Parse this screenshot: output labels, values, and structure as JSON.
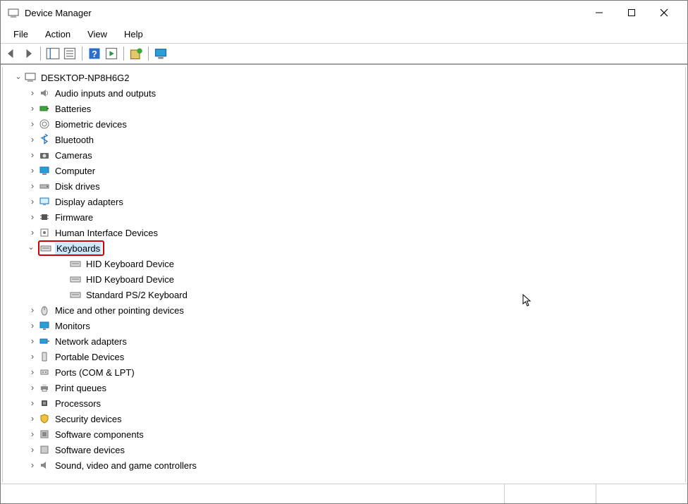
{
  "window": {
    "title": "Device Manager"
  },
  "menubar": {
    "items": [
      "File",
      "Action",
      "View",
      "Help"
    ]
  },
  "toolbar": {
    "buttons": [
      "back",
      "forward",
      "sep",
      "show-hide",
      "properties",
      "sep",
      "help",
      "action-center",
      "sep",
      "update-driver",
      "sep",
      "scan-hardware"
    ]
  },
  "tree": {
    "root": "DESKTOP-NP8H6G2",
    "selected": "Keyboards",
    "nodes": [
      {
        "label": "Audio inputs and outputs",
        "icon": "speaker"
      },
      {
        "label": "Batteries",
        "icon": "battery"
      },
      {
        "label": "Biometric devices",
        "icon": "fingerprint"
      },
      {
        "label": "Bluetooth",
        "icon": "bluetooth"
      },
      {
        "label": "Cameras",
        "icon": "camera"
      },
      {
        "label": "Computer",
        "icon": "computer"
      },
      {
        "label": "Disk drives",
        "icon": "disk"
      },
      {
        "label": "Display adapters",
        "icon": "display"
      },
      {
        "label": "Firmware",
        "icon": "chip"
      },
      {
        "label": "Human Interface Devices",
        "icon": "hid"
      },
      {
        "label": "Keyboards",
        "icon": "keyboard",
        "expanded": true,
        "highlighted": true,
        "selected": true,
        "children": [
          {
            "label": "HID Keyboard Device",
            "icon": "keyboard"
          },
          {
            "label": "HID Keyboard Device",
            "icon": "keyboard"
          },
          {
            "label": "Standard PS/2 Keyboard",
            "icon": "keyboard"
          }
        ]
      },
      {
        "label": "Mice and other pointing devices",
        "icon": "mouse"
      },
      {
        "label": "Monitors",
        "icon": "monitor"
      },
      {
        "label": "Network adapters",
        "icon": "network"
      },
      {
        "label": "Portable Devices",
        "icon": "portable"
      },
      {
        "label": "Ports (COM & LPT)",
        "icon": "port"
      },
      {
        "label": "Print queues",
        "icon": "printer"
      },
      {
        "label": "Processors",
        "icon": "cpu"
      },
      {
        "label": "Security devices",
        "icon": "security"
      },
      {
        "label": "Software components",
        "icon": "component"
      },
      {
        "label": "Software devices",
        "icon": "component"
      },
      {
        "label": "Sound, video and game controllers",
        "icon": "sound"
      }
    ]
  }
}
